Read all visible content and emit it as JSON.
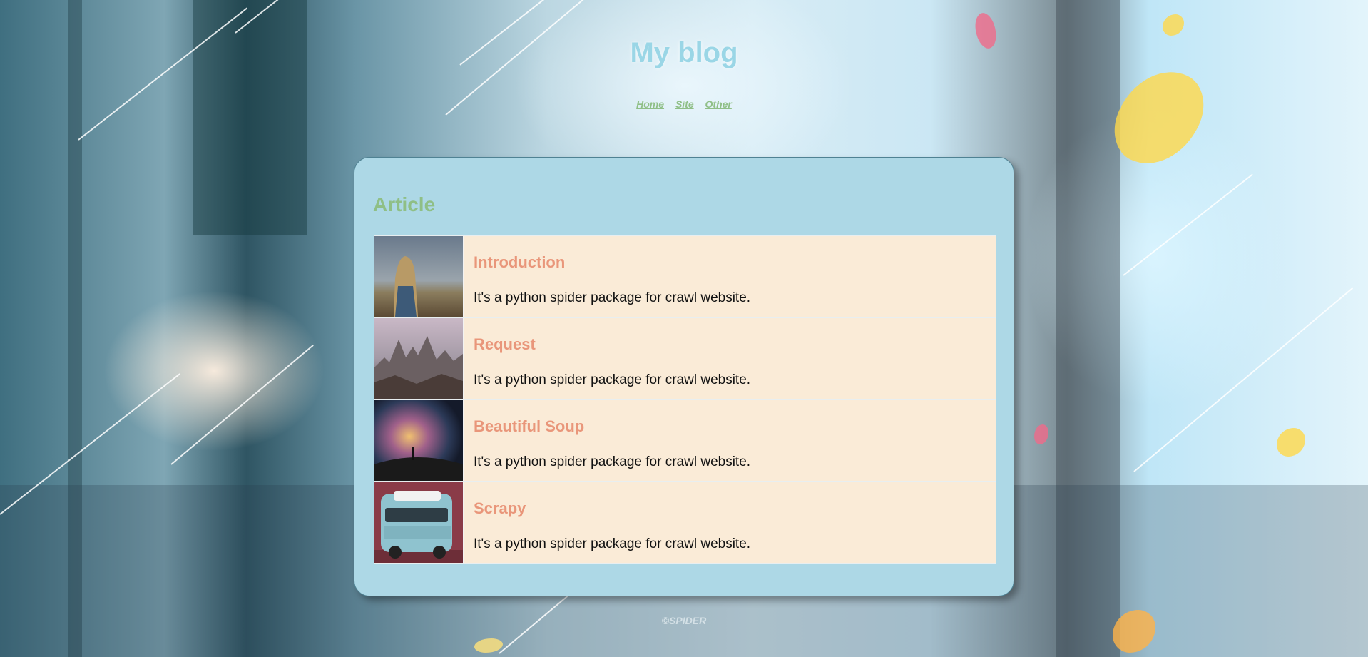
{
  "site": {
    "title": "My blog",
    "nav": [
      {
        "label": "Home"
      },
      {
        "label": "Site"
      },
      {
        "label": "Other"
      }
    ]
  },
  "main": {
    "section_title": "Article",
    "articles": [
      {
        "title": "Introduction",
        "description": "It's a python spider package for crawl website.",
        "thumbnail": "person-in-field"
      },
      {
        "title": "Request",
        "description": "It's a python spider package for crawl website.",
        "thumbnail": "mountain-peaks"
      },
      {
        "title": "Beautiful Soup",
        "description": "It's a python spider package for crawl website.",
        "thumbnail": "night-sky-milky-way"
      },
      {
        "title": "Scrapy",
        "description": "It's a python spider package for crawl website.",
        "thumbnail": "blue-camper-van"
      }
    ]
  },
  "footer": {
    "copyright": "©SPIDER"
  },
  "colors": {
    "card_bg": "#add8e6",
    "article_bg": "#faebd7",
    "article_title": "#e9967a",
    "section_title": "#8fbf86",
    "site_title": "#9ad6e6"
  }
}
